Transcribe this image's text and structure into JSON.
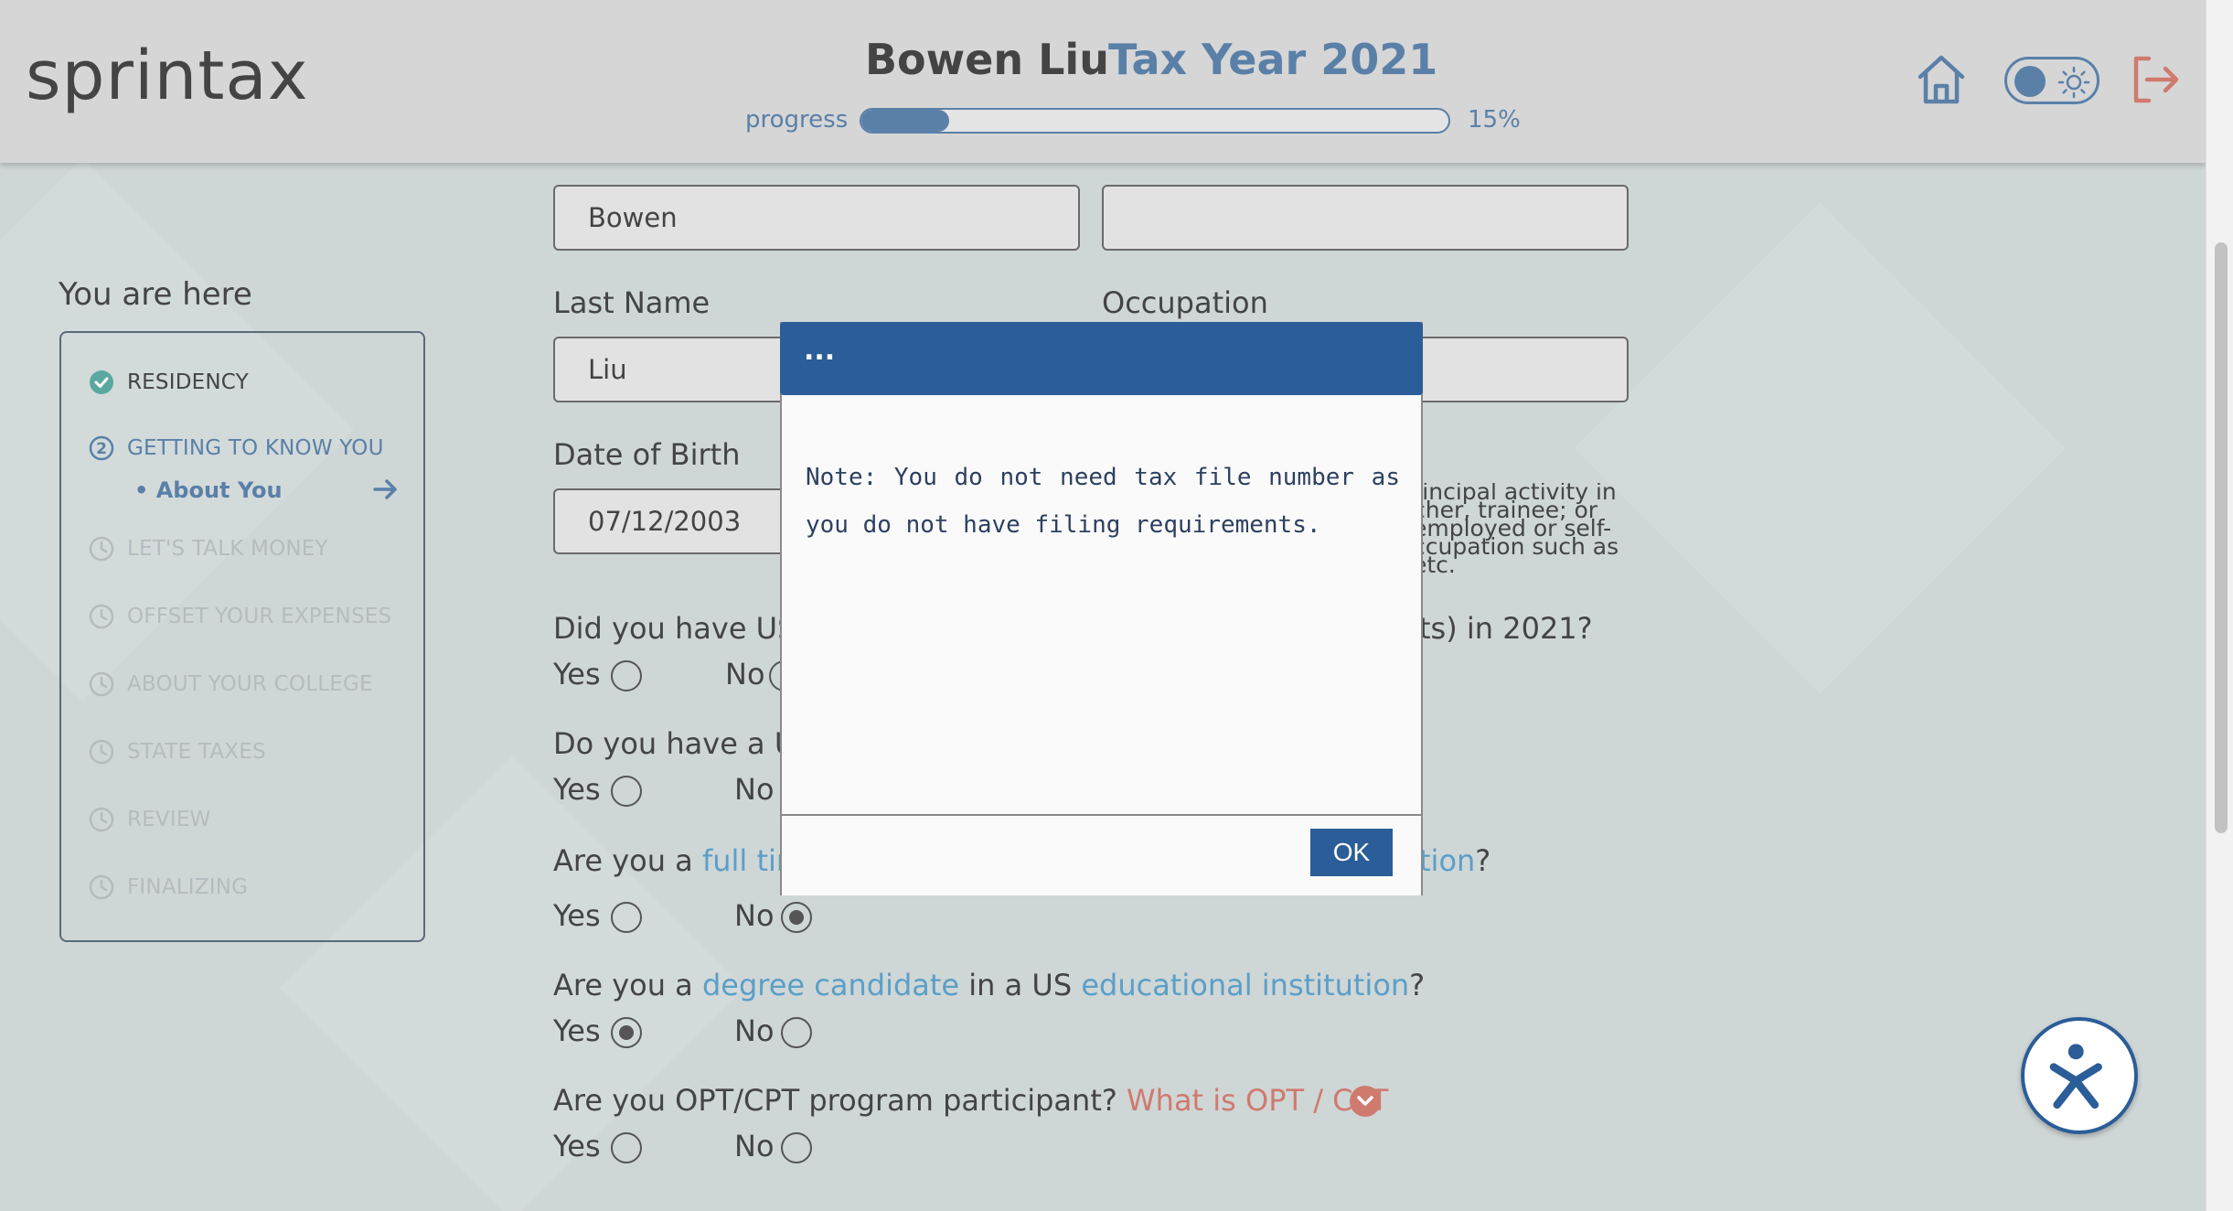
{
  "header": {
    "logo": "sprintax",
    "user_name": "Bowen Liu",
    "tax_year": "Tax Year 2021",
    "progress_label": "progress",
    "progress_percent": "15%",
    "progress_value": 0.15
  },
  "sidebar": {
    "title": "You are here",
    "steps": [
      {
        "label": "RESIDENCY",
        "state": "done"
      },
      {
        "label": "GETTING TO KNOW YOU",
        "state": "current"
      },
      {
        "label": "LET'S TALK MONEY",
        "state": "future"
      },
      {
        "label": "OFFSET YOUR EXPENSES",
        "state": "future"
      },
      {
        "label": "ABOUT YOUR COLLEGE",
        "state": "future"
      },
      {
        "label": "STATE TAXES",
        "state": "future"
      },
      {
        "label": "REVIEW",
        "state": "future"
      },
      {
        "label": "FINALIZING",
        "state": "future"
      }
    ],
    "current_step_number": "2",
    "current_substep": "• About You"
  },
  "form": {
    "first_name_value": "Bowen",
    "middle_name_value": "",
    "last_name_label": "Last Name",
    "last_name_value": "Liu",
    "occupation_label": "Occupation",
    "occupation_value": "",
    "dob_label": "Date of Birth",
    "dob_value": "07/12/2003",
    "occupation_help": "rincipal activity in cher, trainee; or employed or self- ccupation such as etc.",
    "q1_start": "Did you have US",
    "q1_end": "ts) in 2021?",
    "q2_start": "Do you have a US",
    "q3_start": "Are you a",
    "q3_link1": "full time",
    "q3_link2_end": "tion",
    "q3_end": "?",
    "q4_start": "Are you a",
    "q4_link1": "degree candidate",
    "q4_mid": "in a US",
    "q4_link2": "educational institution",
    "q4_end": "?",
    "q5_text": "Are you OPT/CPT program participant?",
    "q5_link": "What is OPT / CPT",
    "yes_label": "Yes",
    "no_label": "No"
  },
  "modal": {
    "title": "...",
    "message": "Note: You do not need tax file number as you do not have filing requirements.",
    "ok_label": "OK"
  },
  "colors": {
    "brand_blue": "#2b5d98",
    "accent_blue": "#5a80a8",
    "link_blue": "#5a9fc8",
    "coral": "#cf7a6e",
    "done_green": "#5aa9a0"
  }
}
